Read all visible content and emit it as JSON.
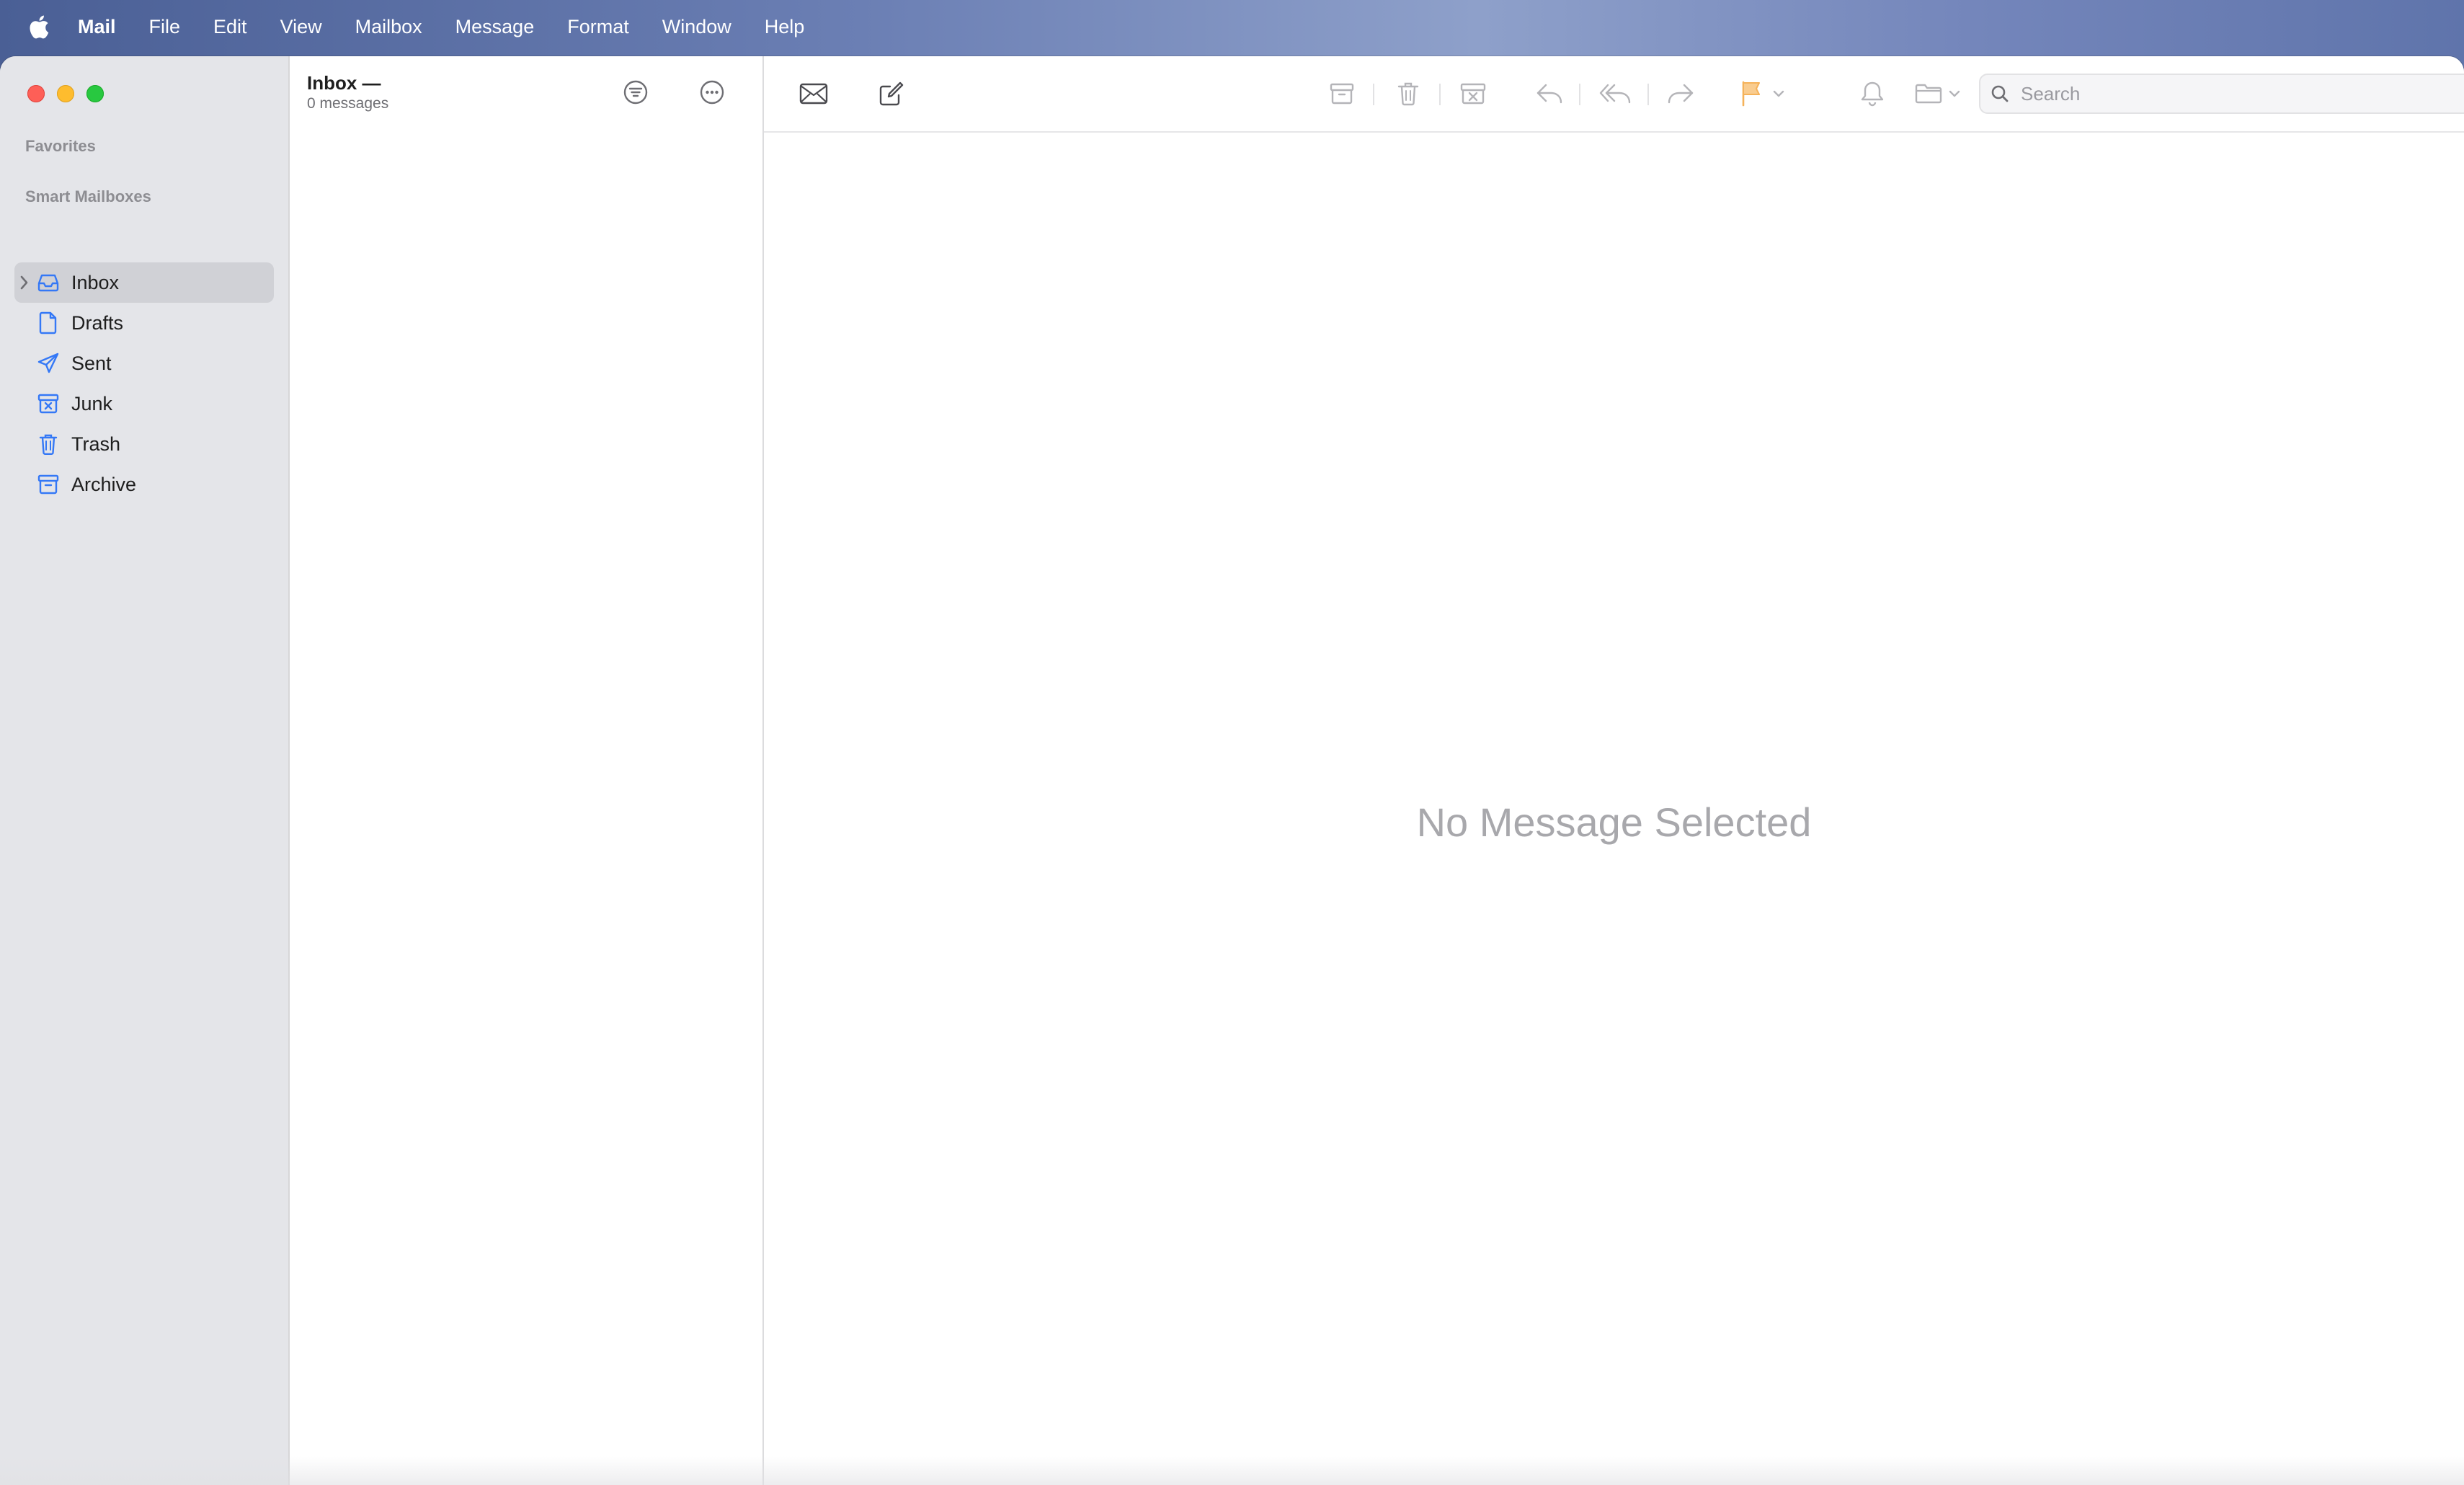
{
  "menubar": {
    "apple_icon": "apple-logo-icon",
    "items": [
      "Mail",
      "File",
      "Edit",
      "View",
      "Mailbox",
      "Message",
      "Format",
      "Window",
      "Help"
    ]
  },
  "sidebar": {
    "favorites_label": "Favorites",
    "smart_mailboxes_label": "Smart Mailboxes",
    "mailboxes": [
      {
        "label": "Inbox",
        "icon": "inbox-tray-icon",
        "selected": true
      },
      {
        "label": "Drafts",
        "icon": "document-icon"
      },
      {
        "label": "Sent",
        "icon": "paper-plane-icon"
      },
      {
        "label": "Junk",
        "icon": "junk-box-icon"
      },
      {
        "label": "Trash",
        "icon": "trash-icon"
      },
      {
        "label": "Archive",
        "icon": "archive-box-icon"
      }
    ]
  },
  "message_list": {
    "title": "Inbox —",
    "count": "0 messages",
    "filter_icon": "filter-icon",
    "more_icon": "ellipsis-circle-icon"
  },
  "toolbar": {
    "icons": [
      "get-mail-icon",
      "compose-icon",
      "archive-icon",
      "trash-icon",
      "junk-icon",
      "reply-icon",
      "reply-all-icon",
      "forward-icon",
      "flag-icon",
      "notify-bell-icon",
      "move-folder-icon"
    ],
    "flag_color": "#f5b25a",
    "search_placeholder": "Search"
  },
  "viewer": {
    "empty_message": "No Message Selected"
  },
  "colors": {
    "accent": "#3478f6",
    "sidebar_bg": "#e4e5e9",
    "selected_bg": "#d0d1d6"
  }
}
